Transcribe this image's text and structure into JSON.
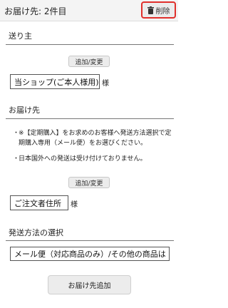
{
  "header": {
    "title": "お届け先: 2件目",
    "delete_label": "削除"
  },
  "sender": {
    "title": "送り主",
    "change_button": "追加/変更",
    "selected": "当ショップ(ご本人様用)",
    "suffix": "様"
  },
  "recipient": {
    "title": "お届け先",
    "notes": [
      "※【定期購入】をお求めのお客様へ発送方法選択で定期購入専用（メール便）をお選びください。",
      "日本国外への発送は受け付けておりません。"
    ],
    "change_button": "追加/変更",
    "selected": "ご注文者住所",
    "suffix": "様"
  },
  "shipping": {
    "title": "発送方法の選択",
    "selected": "メール便（対応商品のみ）/その他の商品は"
  },
  "footer": {
    "add_button": "お届け先追加"
  }
}
